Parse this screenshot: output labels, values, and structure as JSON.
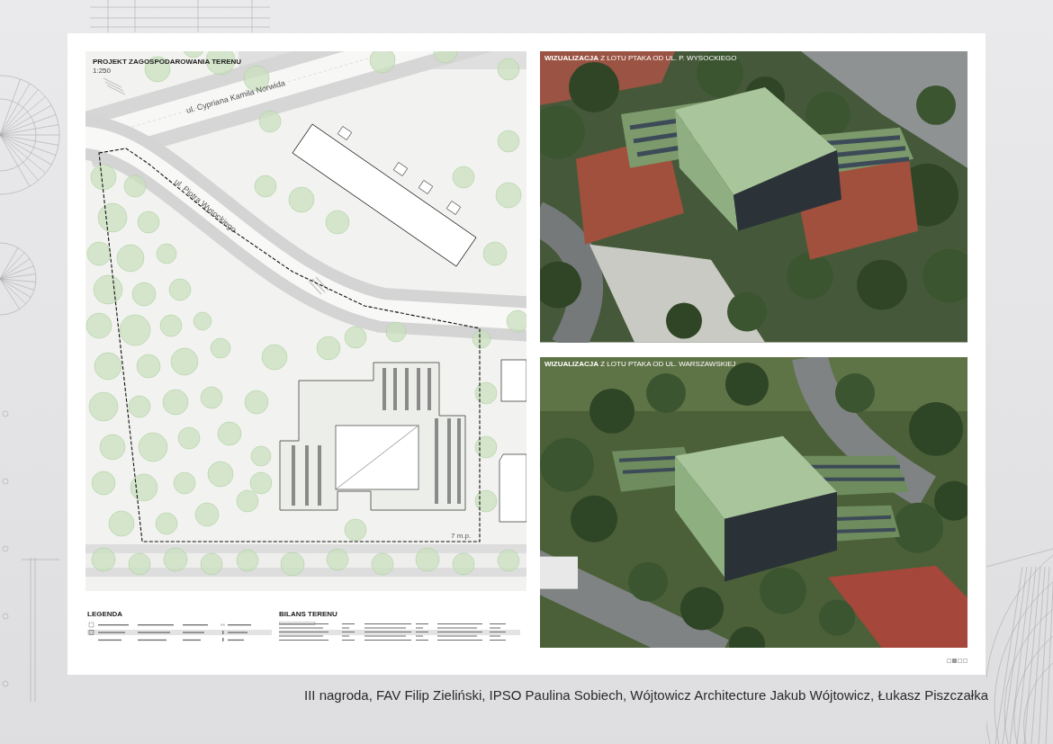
{
  "site_plan": {
    "title": "PROJEKT ZAGOSPODAROWANIA TERENU",
    "scale": "1:250",
    "street_labels": [
      {
        "text": "ul. Cypriana Kamila Norwida"
      },
      {
        "text": "ul. Piotra Wysockiego"
      }
    ],
    "parking_label": "7 m.p.",
    "legend": {
      "heading": "LEGENDA"
    },
    "site_balance": {
      "heading": "BILANS TERENU"
    }
  },
  "visualizations": [
    {
      "caption": "**WIZUALIZACJA** Z LOTU PTAKA OD UL. P. WYSOCKIEGO"
    },
    {
      "caption": "**WIZUALIZACJA** Z LOTU PTAKA OD UL. WARSZAWSKIEJ"
    }
  ],
  "pager": [
    {
      "selected": false
    },
    {
      "selected": true
    },
    {
      "selected": false
    },
    {
      "selected": false
    }
  ],
  "credits": "III nagroda, FAV Filip Zieliński, IPSO Paulina Sobiech, Wójtowicz Architecture Jakub Wójtowicz, Łukasz Piszczałka"
}
